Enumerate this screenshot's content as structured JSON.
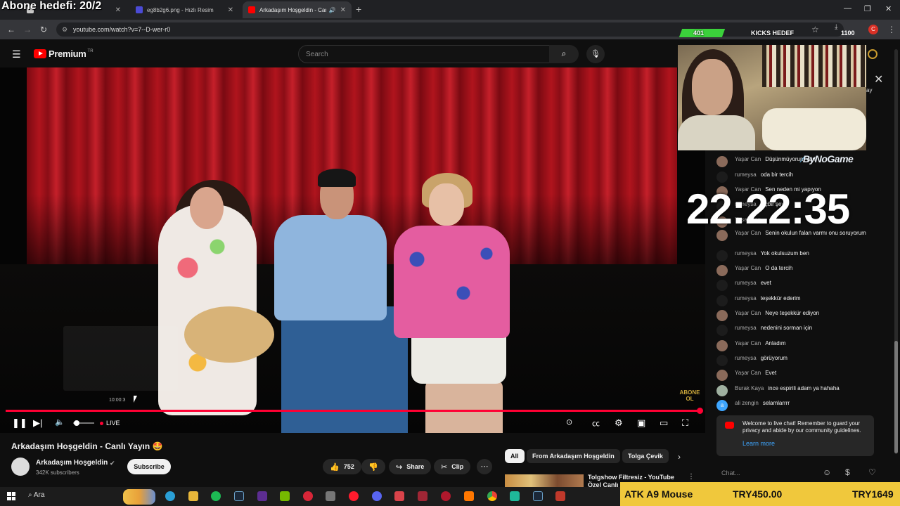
{
  "overlay": {
    "goal": "Abone hedefi: 20/2"
  },
  "browser": {
    "tabs": [
      {
        "label": "",
        "color": "#c9c9c9"
      },
      {
        "label": "eg8b2g6.png - Hızlı Resim",
        "color": "#4b4bd6"
      },
      {
        "label": "Arkadaşım Hoşgeldin - Can",
        "color": "#ff0000"
      }
    ],
    "url": "youtube.com/watch?v=7--D-wer-r0",
    "new_tab": "+",
    "profile_initial": "C"
  },
  "kicks": {
    "current": "401",
    "label": "KICKS HEDEF",
    "target": "1100",
    "progress": 0.36
  },
  "youtube": {
    "logo_text": "Premium",
    "country": "TR",
    "search_placeholder": "Search",
    "player": {
      "live_label": "LIVE",
      "hover_time": "10:00:3",
      "watermark": "ABONE OL",
      "volume": 0.2
    },
    "video": {
      "title": "Arkadaşım Hoşgeldin - Canlı Yayın 🤩",
      "channel": "Arkadaşım Hoşgeldin",
      "subscribers": "342K subscribers",
      "subscribe_label": "Subscribe",
      "likes": "752",
      "share_label": "Share",
      "clip_label": "Clip",
      "more_label": "⋯"
    },
    "chips": [
      "All",
      "From Arkadaşım Hoşgeldin",
      "Tolga Çevik"
    ],
    "recommended": {
      "title_line1": "Tolgshow Filtresiz - YouTube",
      "title_line2": "Özel Canlı"
    }
  },
  "stream_overlay": {
    "sponsor_prefix": "By",
    "sponsor_name": "NoGame",
    "clock": "22:22:35",
    "cam_side_text": "ay"
  },
  "chat": {
    "messages": [
      {
        "name": "Yaşar Can",
        "text": "Düşünmüyorum yani",
        "avatar": "photo"
      },
      {
        "name": "rumeysa",
        "text": "oda bir tercih",
        "avatar": "dark"
      },
      {
        "name": "Yaşar Can",
        "text": "Sen neden mi yapıyon",
        "avatar": "photo"
      },
      {
        "name": "rumeysa",
        "text": "hiçbir şey",
        "avatar": "dark"
      },
      {
        "name": "Yaşar Can",
        "text": "",
        "avatar": "photo"
      },
      {
        "name": "Yaşar Can",
        "text": "Senin okulun falan varmı onu soruyorum",
        "avatar": "photo"
      },
      {
        "name": "rumeysa",
        "text": "Yok okulsuzum ben",
        "avatar": "dark"
      },
      {
        "name": "Yaşar Can",
        "text": "O da tercih",
        "avatar": "photo"
      },
      {
        "name": "rumeysa",
        "text": "evet",
        "avatar": "dark"
      },
      {
        "name": "rumeysa",
        "text": "teşekkür ederim",
        "avatar": "dark"
      },
      {
        "name": "Yaşar Can",
        "text": "Neye teşekkür ediyon",
        "avatar": "photo"
      },
      {
        "name": "rumeysa",
        "text": "nedenini sorman için",
        "avatar": "dark"
      },
      {
        "name": "Yaşar Can",
        "text": "Anladım",
        "avatar": "photo"
      },
      {
        "name": "rumeysa",
        "text": "görüyorum",
        "avatar": "dark"
      },
      {
        "name": "Yaşar Can",
        "text": "Evet",
        "avatar": "photo"
      },
      {
        "name": "Burak Kaya",
        "text": "ince espirili adam ya hahaha",
        "avatar": "photo2"
      },
      {
        "name": "ali zengin",
        "text": "selamlarrrr",
        "avatar": "letter"
      }
    ],
    "welcome_text": "Welcome to live chat! Remember to guard your privacy and abide by our community guidelines.",
    "learn_more": "Learn more",
    "input_placeholder": "Chat...",
    "letter_avatar": "a"
  },
  "taskbar": {
    "search_label": "Ara"
  },
  "ad": {
    "product": "ATK A9 Mouse",
    "price_sale": "TRY450.00",
    "price_orig": "TRY1649"
  },
  "colors": {
    "live_red": "#ff0033",
    "kick_green": "#3bd13b",
    "ad_yellow": "#f0c83c",
    "link_blue": "#3ea6ff"
  }
}
